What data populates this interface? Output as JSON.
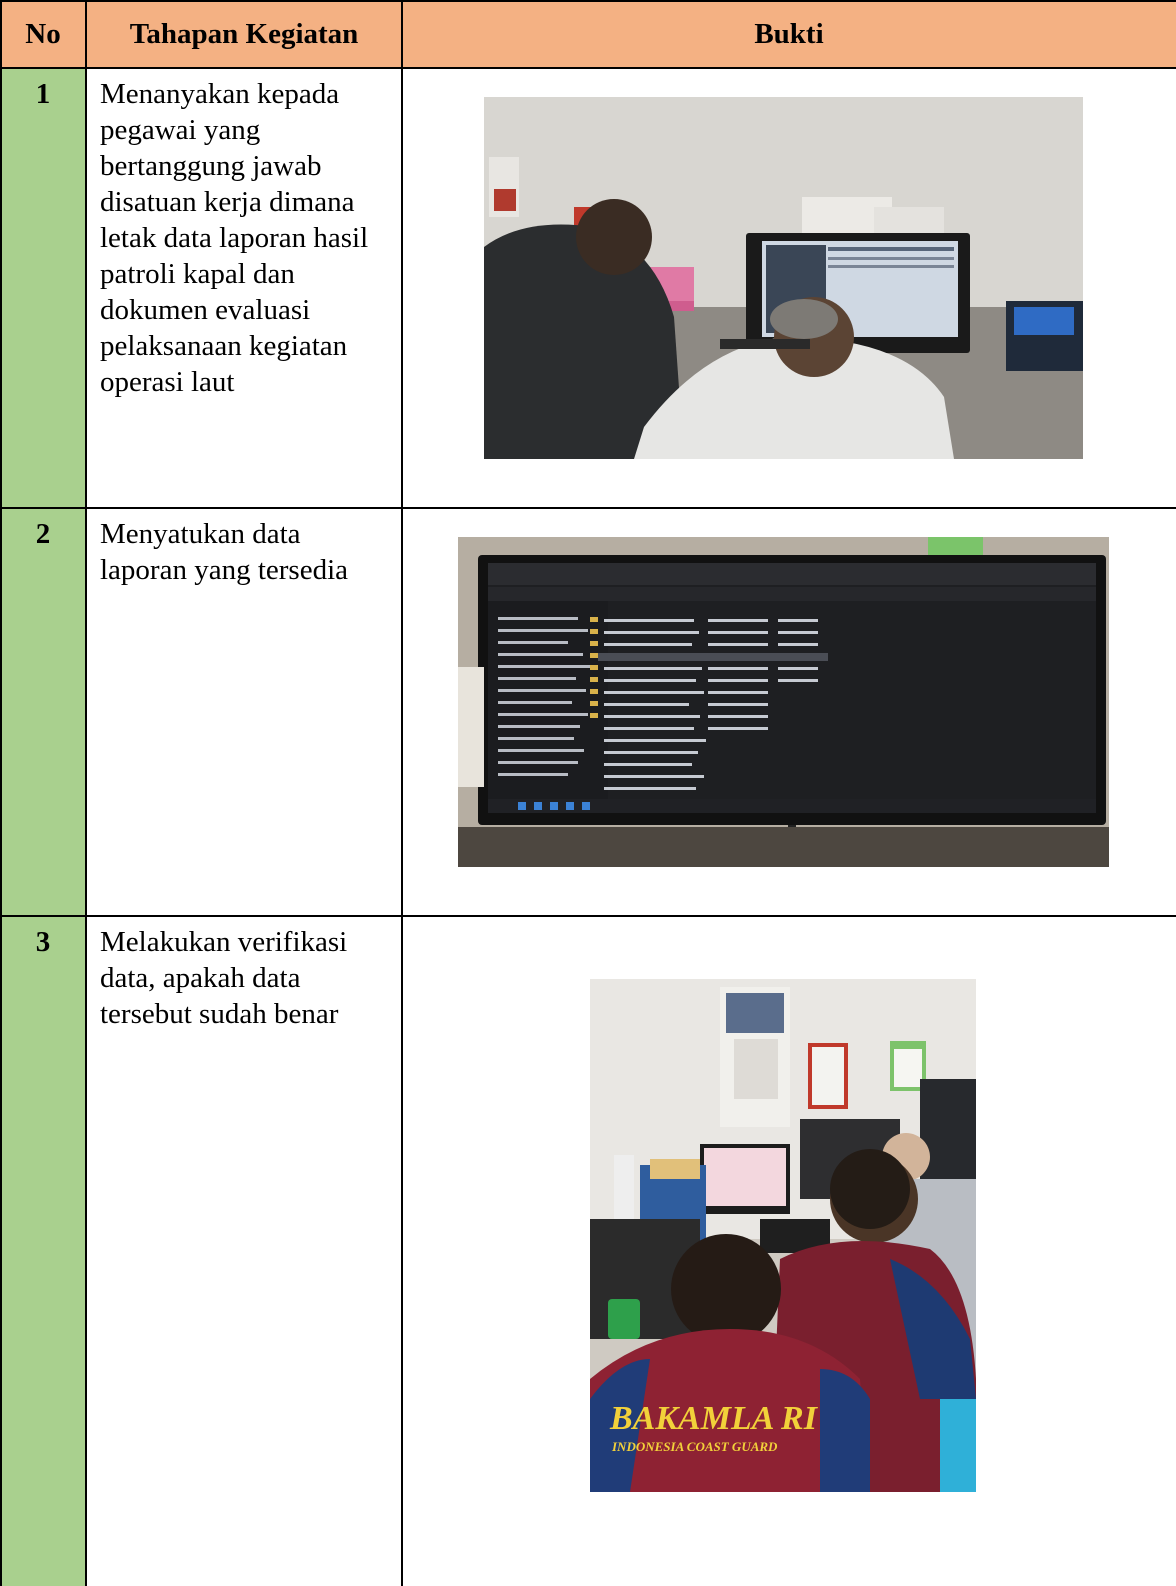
{
  "header": {
    "no": "No",
    "stage": "Tahapan Kegiatan",
    "evidence": "Bukti"
  },
  "rows": [
    {
      "no": "1",
      "stage": "Menanyakan kepada pegawai yang bertanggung jawab disatuan kerja dimana letak data laporan hasil patroli kapal dan dokumen evaluasi pelaksanaan kegiatan operasi laut"
    },
    {
      "no": "2",
      "stage": "Menyatukan data laporan yang tersedia"
    },
    {
      "no": "3",
      "stage": "Melakukan verifikasi data, apakah data tersebut sudah benar"
    }
  ],
  "photo3": {
    "shirt_text": "BAKAMLA RI",
    "shirt_sub": "INDONESIA COAST GUARD"
  },
  "colors": {
    "header_bg": "#f4b183",
    "no_col_bg": "#a9d08e"
  }
}
